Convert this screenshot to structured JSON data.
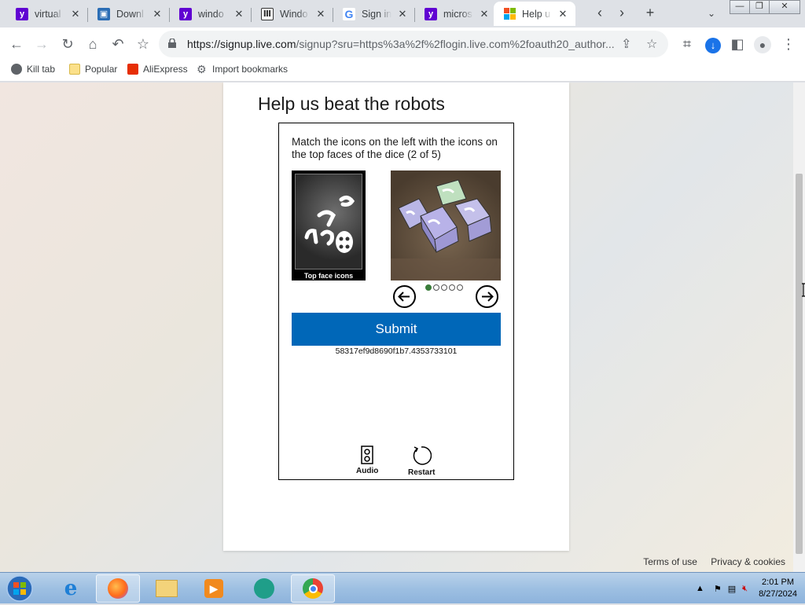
{
  "tabs": [
    {
      "title": "virtual",
      "favicon": "yahoo-icon",
      "color": "#6001d2"
    },
    {
      "title": "Downl",
      "favicon": "download-page-icon",
      "color": "#2a6db5"
    },
    {
      "title": "windo",
      "favicon": "yahoo-icon",
      "color": "#6001d2"
    },
    {
      "title": "Windo",
      "favicon": "museum-icon",
      "color": "#333333"
    },
    {
      "title": "Sign in",
      "favicon": "google-icon",
      "color": "#4285f4"
    },
    {
      "title": "micros",
      "favicon": "yahoo-icon",
      "color": "#6001d2"
    },
    {
      "title": "Help u",
      "favicon": "microsoft-icon",
      "color": "#f25022",
      "active": true
    }
  ],
  "address_bar": {
    "url_host": "https://signup.live.com",
    "url_path": "/signup?sru=https%3a%2f%2flogin.live.com%2foauth20_author..."
  },
  "bookmarks": [
    {
      "label": "Kill tab",
      "icon": "globe-icon"
    },
    {
      "label": "Popular",
      "icon": "folder-icon"
    },
    {
      "label": "AliExpress",
      "icon": "aliexpress-icon"
    },
    {
      "label": "Import bookmarks",
      "icon": "gear-icon"
    }
  ],
  "page": {
    "heading": "Help us beat the robots",
    "captcha": {
      "instruction": "Match the icons on the left with the icons on the top faces of the dice (2 of 5)",
      "left_image_caption": "Top face icons",
      "carousel_total": 5,
      "carousel_current": 1,
      "submit_label": "Submit",
      "token": "58317ef9d8690f1b7.4353733101",
      "audio_label": "Audio",
      "restart_label": "Restart"
    },
    "footer": {
      "terms": "Terms of use",
      "privacy": "Privacy & cookies"
    }
  },
  "taskbar": {
    "apps": [
      "internet-explorer-icon",
      "firefox-icon",
      "file-explorer-icon",
      "media-player-icon",
      "meet-app-icon",
      "chrome-icon"
    ],
    "time": "2:01 PM",
    "date": "8/27/2024"
  },
  "colors": {
    "submit_bg": "#0067b8",
    "tab_bar": "#dee1e6"
  }
}
